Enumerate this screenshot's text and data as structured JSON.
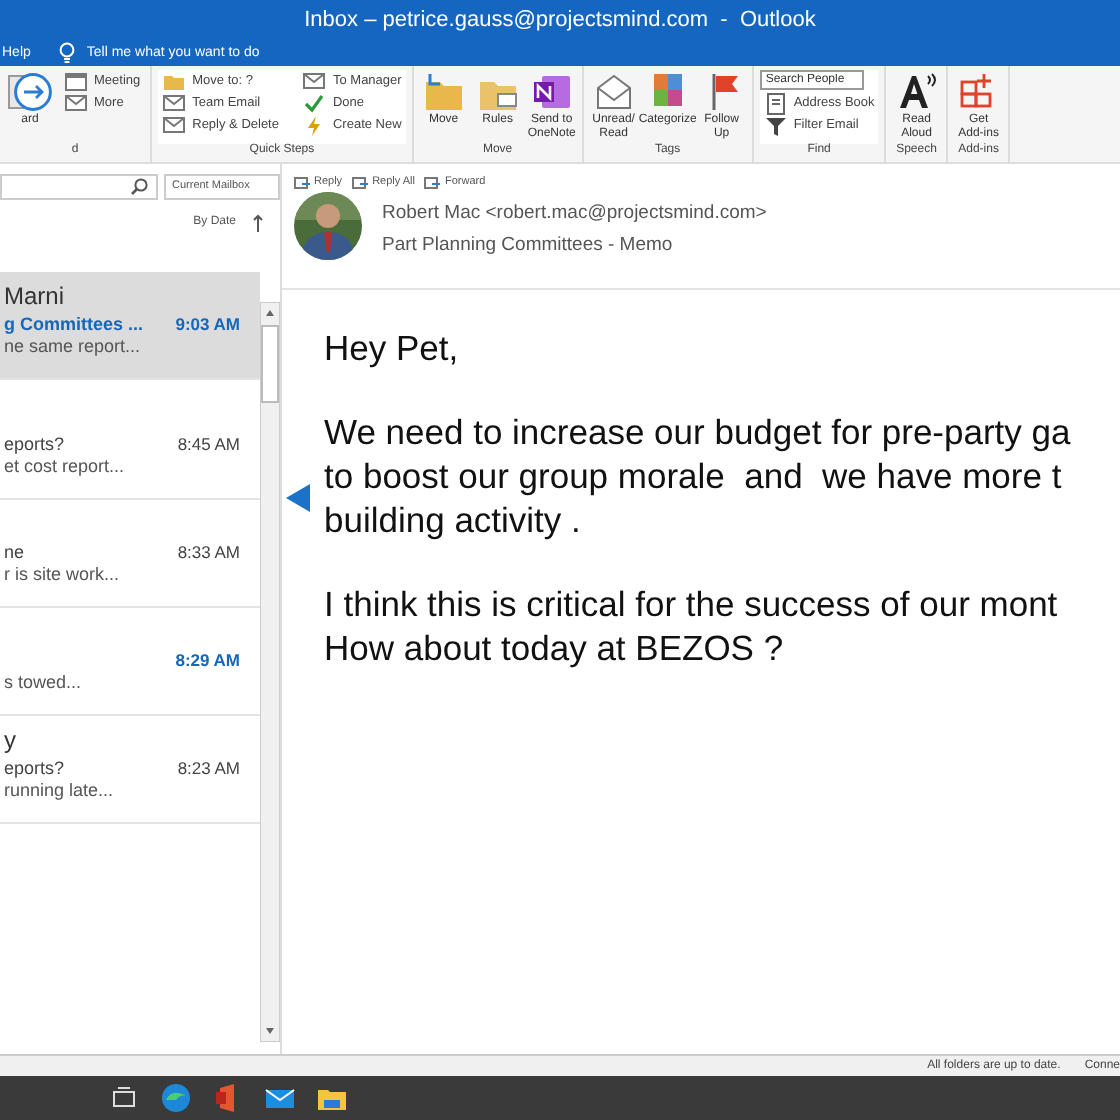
{
  "window": {
    "title": "Inbox – petrice.gauss@projectsmind.com  -  Outlook"
  },
  "menu": {
    "items": [
      {
        "label": "Help"
      }
    ],
    "tell_me": "Tell me what you want to do"
  },
  "ribbon": {
    "groups": [
      {
        "label": "d",
        "items": [
          {
            "label": "ard",
            "kind": "large"
          },
          {
            "label": "Meeting",
            "kind": "small"
          },
          {
            "label": "More",
            "kind": "small"
          }
        ]
      },
      {
        "label": "Quick Steps",
        "items": [
          {
            "label": "Move to: ?",
            "kind": "small"
          },
          {
            "label": "Team Email",
            "kind": "small"
          },
          {
            "label": "Reply & Delete",
            "kind": "small"
          },
          {
            "label": "To Manager",
            "kind": "small"
          },
          {
            "label": "Done",
            "kind": "small"
          },
          {
            "label": "Create New",
            "kind": "small"
          }
        ]
      },
      {
        "label": "Move",
        "items": [
          {
            "label": "Move",
            "kind": "large"
          },
          {
            "label": "Rules",
            "kind": "large"
          },
          {
            "label": "Send to OneNote",
            "kind": "large"
          }
        ]
      },
      {
        "label": "Tags",
        "items": [
          {
            "label": "Unread/ Read",
            "kind": "large"
          },
          {
            "label": "Categorize",
            "kind": "large"
          },
          {
            "label": "Follow Up",
            "kind": "large"
          }
        ]
      },
      {
        "label": "Find",
        "items": [
          {
            "placeholder": "Search People",
            "kind": "field"
          },
          {
            "label": "Address Book",
            "kind": "small"
          },
          {
            "label": "Filter Email",
            "kind": "small"
          }
        ]
      },
      {
        "label": "Speech",
        "items": [
          {
            "label": "Read Aloud",
            "kind": "large"
          }
        ]
      },
      {
        "label": "Add-ins",
        "items": [
          {
            "label": "Get Add-ins",
            "kind": "large"
          }
        ]
      }
    ]
  },
  "mail_list": {
    "scope": "Current Mailbox",
    "sort": "By Date",
    "items": [
      {
        "sender": "Marni",
        "subject": "g Committees ...",
        "preview": "ne same report...",
        "time": "9:03 AM",
        "selected": true,
        "unread": false
      },
      {
        "subject": "eports?",
        "preview": "et cost report...",
        "time": "8:45 AM",
        "selected": false,
        "unread": false
      },
      {
        "subject": "ne",
        "preview": "r is site work...",
        "time": "8:33 AM",
        "selected": false,
        "unread": false
      },
      {
        "preview": "s towed...",
        "time": "8:29 AM",
        "selected": false,
        "unread": true
      },
      {
        "sender": "y",
        "subject": "eports?",
        "preview": "running late...",
        "time": "8:23 AM",
        "selected": false,
        "unread": false
      }
    ]
  },
  "reading_pane": {
    "actions": [
      {
        "label": "Reply"
      },
      {
        "label": "Reply All"
      },
      {
        "label": "Forward"
      }
    ],
    "sender": "Robert Mac <robert.mac@projectsmind.com>",
    "subject": "Part Planning Committees - Memo",
    "body": [
      {
        "lines": [
          "Hey Pet,"
        ]
      },
      {
        "lines": [
          "We need to increase our budget for pre-party ga",
          "to boost our group morale  and  we have more t",
          "building activity ."
        ]
      },
      {
        "lines": [
          "I think this is critical for the success of our mont",
          "How about today at BEZOS ?"
        ]
      }
    ]
  },
  "status_bar": {
    "items": [
      "All folders are up to date.",
      "Conne"
    ]
  }
}
